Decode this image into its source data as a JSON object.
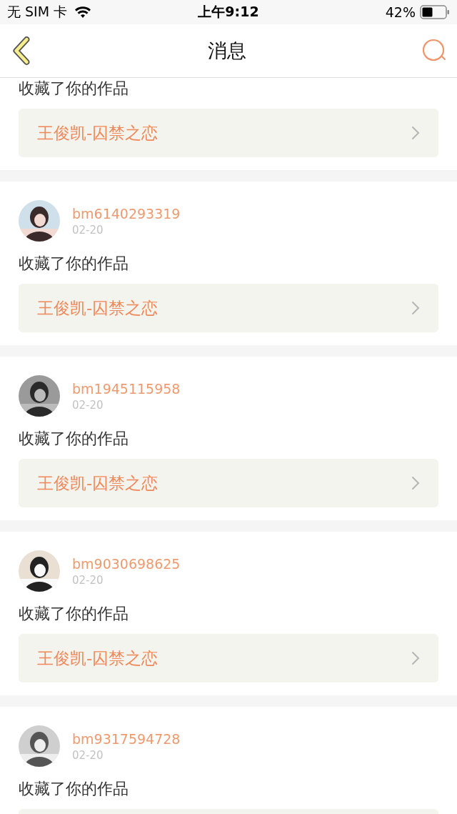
{
  "status_bar": {
    "carrier": "无 SIM 卡",
    "time": "上午9:12",
    "battery": "42%"
  },
  "nav": {
    "title": "消息"
  },
  "messages": [
    {
      "action": "收藏了你的作品",
      "work": "王俊凯-囚禁之恋"
    },
    {
      "user": "bm6140293319",
      "date": "02-20",
      "action": "收藏了你的作品",
      "work": "王俊凯-囚禁之恋"
    },
    {
      "user": "bm1945115958",
      "date": "02-20",
      "action": "收藏了你的作品",
      "work": "王俊凯-囚禁之恋"
    },
    {
      "user": "bm9030698625",
      "date": "02-20",
      "action": "收藏了你的作品",
      "work": "王俊凯-囚禁之恋"
    },
    {
      "user": "bm9317594728",
      "date": "02-20",
      "action": "收藏了你的作品"
    }
  ]
}
